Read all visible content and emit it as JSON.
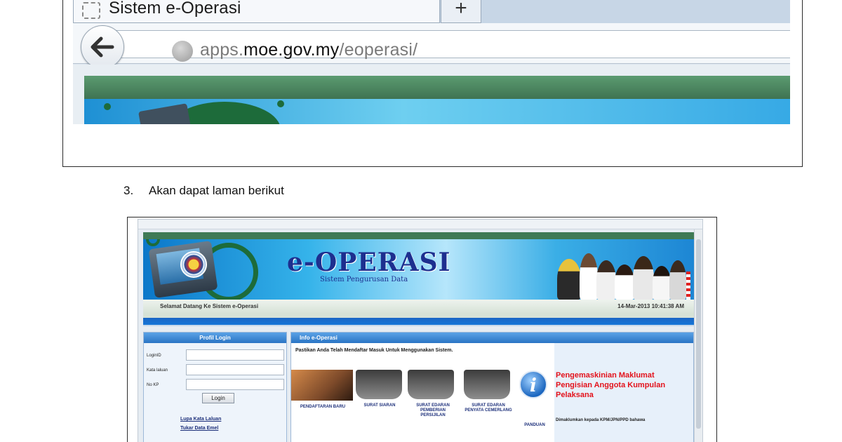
{
  "browser_top": {
    "tab_title": "Sistem e-Operasi",
    "new_tab_symbol": "+",
    "url_prefix": "apps.",
    "url_domain": "moe.gov.my",
    "url_path": "/eoperasi/"
  },
  "step": {
    "number": "3.",
    "text": "Akan dapat laman berikut"
  },
  "eoperasi": {
    "banner_title": "e-OPERASI",
    "banner_subtitle": "Sistem Pengurusan Data",
    "welcome": "Selamat Datang Ke Sistem e-Operasi",
    "datetime": "14-Mar-2013 10:41:38 AM",
    "profil": {
      "title": "Profil Login",
      "login_id_label": "LoginID",
      "password_label": "Kata laluan",
      "nokp_label": "No KP",
      "login_button": "Login",
      "forgot_password": "Lupa Kata Laluan",
      "update_email": "Tukar Data Emel"
    },
    "info": {
      "title": "Info e-Operasi",
      "notice": "Pastikan Anda Telah Mendaftar Masuk Untuk Menggunakan Sistem.",
      "tiles": [
        {
          "label": "PENDAFTARAN BARU"
        },
        {
          "label": "SURAT SIARAN"
        },
        {
          "label": "SURAT EDARAN PEMBERIAN PERSIJILAN"
        },
        {
          "label": "SURAT EDARAN PENYATA CEMERLANG"
        },
        {
          "label": "PANDUAN"
        }
      ],
      "highlight": "Pengemaskinian Maklumat Pengisian Anggota Kumpulan Pelaksana",
      "footnote": "Dimaklumkan kepada KPM/JPN/PPD bahawa"
    }
  },
  "colors": {
    "banner_green": "#3f7352",
    "banner_blue": "#1e90d4",
    "title_navy": "#1d2f8f",
    "highlight_red": "#e3121b"
  }
}
